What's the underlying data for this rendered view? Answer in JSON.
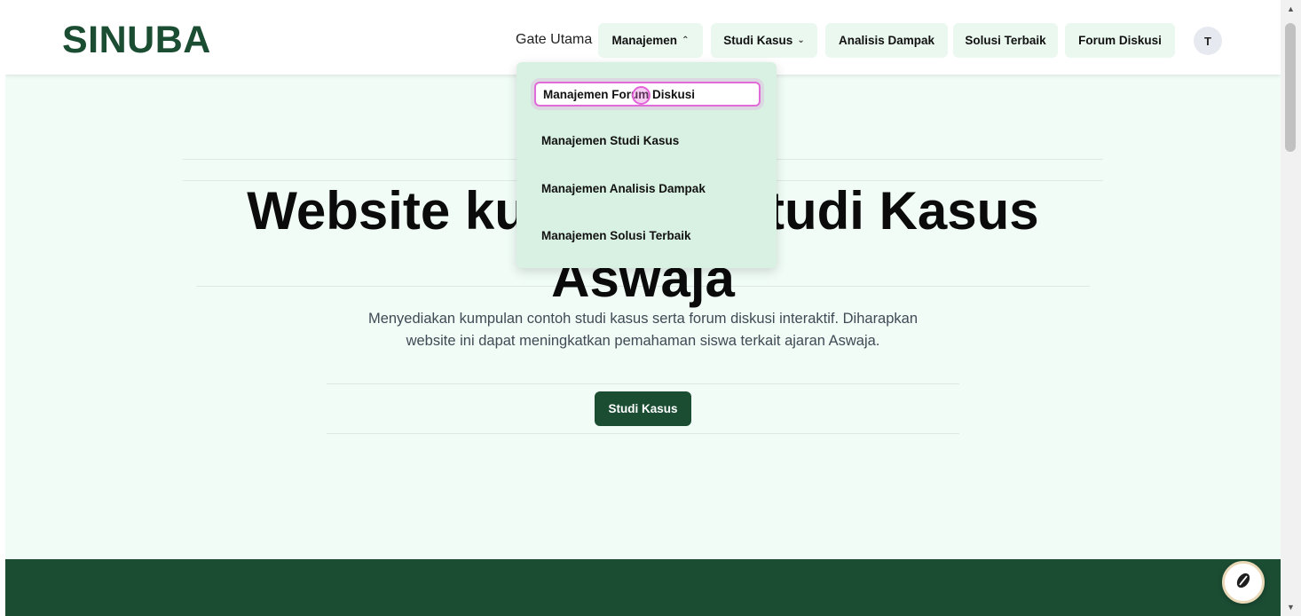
{
  "navbar": {
    "logo": "SINUBA",
    "gate_label": "Gate Utama",
    "manajemen_label": "Manajemen",
    "studi_kasus_label": "Studi Kasus",
    "analisis_label": "Analisis Dampak",
    "solusi_label": "Solusi Terbaik",
    "forum_label": "Forum Diskusi",
    "avatar_initial": "T"
  },
  "dropdown": {
    "items": [
      "Manajemen Forum Diskusi",
      "Manajemen Studi Kasus",
      "Manajemen Analisis Dampak",
      "Manajemen Solusi Terbaik"
    ]
  },
  "hero": {
    "title_line1": "Website kumpulan Studi Kasus",
    "title_line2": "Aswaja",
    "subtitle_line1": "Menyediakan kumpulan contoh studi kasus serta forum diskusi interaktif. Diharapkan",
    "subtitle_line2": "website ini dapat meningkatkan pemahaman siswa terkait ajaran Aswaja.",
    "cta_label": "Studi Kasus"
  },
  "colors": {
    "brand": "#1b4d33",
    "hero_bg": "#f1fcf6",
    "nav_button_bg": "#eaf8ef",
    "dropdown_bg": "#d9f1e3",
    "focus_ring": "#e16bd8"
  },
  "icons": {
    "fab": "coffee-bean-icon"
  }
}
